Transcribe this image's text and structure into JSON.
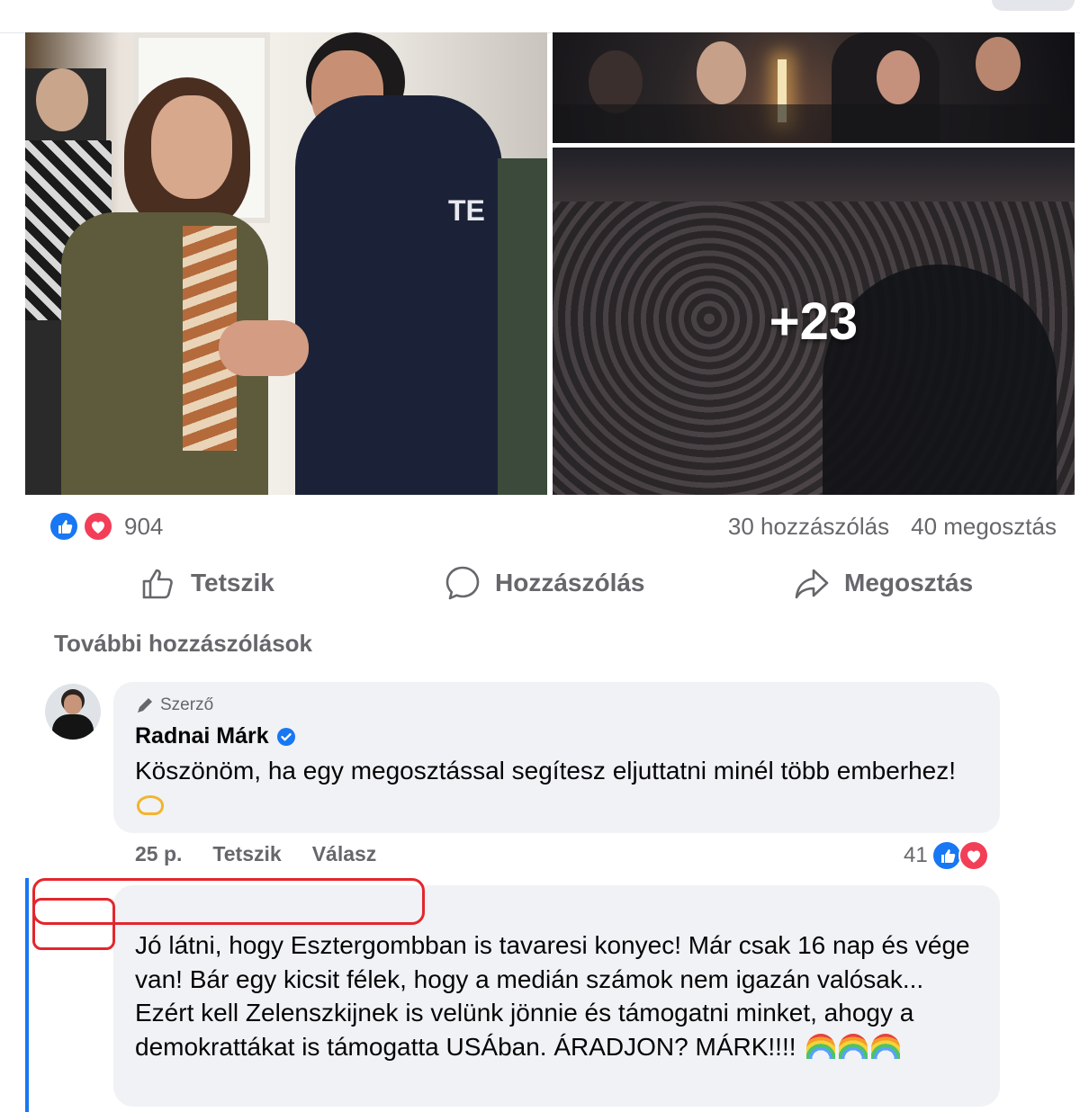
{
  "media": {
    "more_photos_label": "+23",
    "hoodie_text": "TE"
  },
  "stats": {
    "reaction_count": "904",
    "comments": "30 hozzászólás",
    "shares": "40 megosztás"
  },
  "actions": {
    "like": "Tetszik",
    "comment": "Hozzászólás",
    "share": "Megosztás"
  },
  "comments_section": {
    "more_comments_label": "További hozzászólások",
    "items": [
      {
        "badge": "Szerző",
        "author": "Radnai Márk",
        "text": "Köszönöm, ha egy megosztással segítesz eljuttatni minél több emberhez!",
        "time": "25 p.",
        "like": "Tetszik",
        "reply": "Válasz",
        "reaction_count": "41"
      },
      {
        "author": "",
        "text": "Jó látni, hogy Esztergombban is tavaresi konyec! Már csak 16 nap és vége van! Bár egy kicsit félek, hogy a medián számok nem igazán valósak... Ezért kell Zelenszkijnek is velünk jönnie és támogatni minket, ahogy a demokrattákat is támogatta USÁban. ÁRADJON? MÁRK!!!!"
      }
    ]
  },
  "colors": {
    "like_blue": "#1877f2",
    "love_red": "#f33e58",
    "secondary_text": "#65676b",
    "bubble_bg": "#f0f2f5",
    "redaction_red": "#e3262d"
  },
  "icons": [
    "like-icon",
    "love-icon",
    "thumbs-up-icon",
    "comment-icon",
    "share-icon",
    "pencil-icon",
    "verified-badge-icon",
    "heart-hands-emoji",
    "rainbow-emoji"
  ]
}
